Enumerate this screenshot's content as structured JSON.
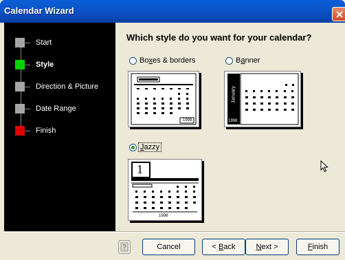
{
  "window": {
    "title": "Calendar Wizard"
  },
  "sidebar": {
    "steps": [
      {
        "label": "Start",
        "state": "done",
        "color": "#a6a6a6"
      },
      {
        "label": "Style",
        "state": "current",
        "color": "#00d400"
      },
      {
        "label": "Direction & Picture",
        "state": "pending",
        "color": "#a6a6a6"
      },
      {
        "label": "Date Range",
        "state": "pending",
        "color": "#a6a6a6"
      },
      {
        "label": "Finish",
        "state": "end",
        "color": "#e00000"
      }
    ]
  },
  "main": {
    "heading": "Which style do you want for your calendar?",
    "options": [
      {
        "label_pre": "Bo",
        "label_key": "x",
        "label_post": "es & borders",
        "selected": false
      },
      {
        "label_pre": "B",
        "label_key": "a",
        "label_post": "nner",
        "selected": false
      },
      {
        "label_pre": "",
        "label_key": "J",
        "label_post": "azzy",
        "selected": true
      }
    ],
    "preview_text": {
      "banner_vertical": "January",
      "year": "1998",
      "jazzy_day": "1"
    }
  },
  "footer": {
    "help_icon": "help-icon",
    "cancel": "Cancel",
    "back_pre": "< ",
    "back_key": "B",
    "back_post": "ack",
    "next_pre": "",
    "next_key": "N",
    "next_post": "ext >",
    "finish_pre": "",
    "finish_key": "F",
    "finish_post": "inish"
  },
  "colors": {
    "titlebar": "#0a5fd8",
    "sidebar": "#000000",
    "dialog_bg": "#ece9d8",
    "current_step": "#00d400",
    "finish_step": "#e00000"
  }
}
